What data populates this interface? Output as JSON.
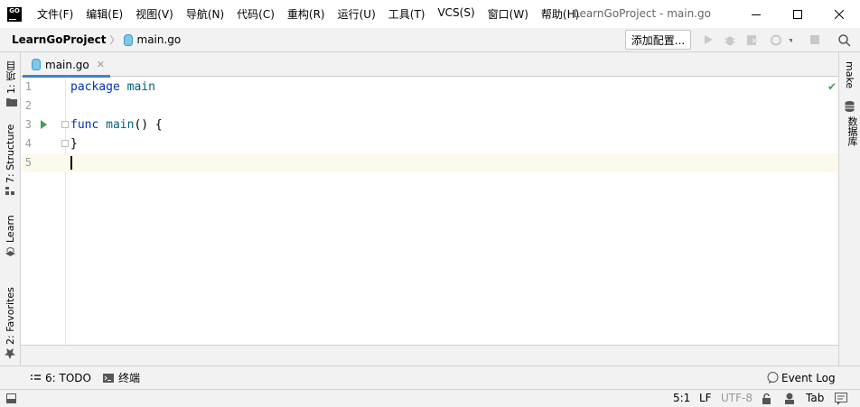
{
  "menu": {
    "logo": "GO",
    "items": [
      "文件(F)",
      "编辑(E)",
      "视图(V)",
      "导航(N)",
      "代码(C)",
      "重构(R)",
      "运行(U)",
      "工具(T)",
      "VCS(S)",
      "窗口(W)",
      "帮助(H)"
    ]
  },
  "window": {
    "title": "LearnGoProject - main.go"
  },
  "navbar": {
    "project": "LearnGoProject",
    "file": "main.go",
    "add_config": "添加配置..."
  },
  "left_tabs": {
    "project": "1: 项目",
    "structure": "7: Structure",
    "learn": "Learn",
    "favorites": "2: Favorites"
  },
  "right_tabs": {
    "make": "make",
    "database": "数据库"
  },
  "editor": {
    "tab_label": "main.go",
    "lines": [
      {
        "num": "1",
        "tokens": [
          {
            "t": "package",
            "c": "kw"
          },
          {
            "t": " "
          },
          {
            "t": "main",
            "c": "fn"
          }
        ]
      },
      {
        "num": "2",
        "tokens": []
      },
      {
        "num": "3",
        "tokens": [
          {
            "t": "func",
            "c": "kw"
          },
          {
            "t": " "
          },
          {
            "t": "main",
            "c": "fn"
          },
          {
            "t": "() {"
          }
        ]
      },
      {
        "num": "4",
        "tokens": [
          {
            "t": "}"
          }
        ]
      },
      {
        "num": "5",
        "tokens": []
      }
    ],
    "current_line": 5
  },
  "bottom_tools": {
    "todo": "6: TODO",
    "terminal": "终端",
    "event_log": "Event Log"
  },
  "status": {
    "position": "5:1",
    "line_sep": "LF",
    "encoding": "UTF-8",
    "indent": "Tab"
  },
  "colors": {
    "keyword": "#0033b3",
    "function": "#00627a",
    "run_green": "#499c54",
    "tab_underline": "#4083c9"
  }
}
